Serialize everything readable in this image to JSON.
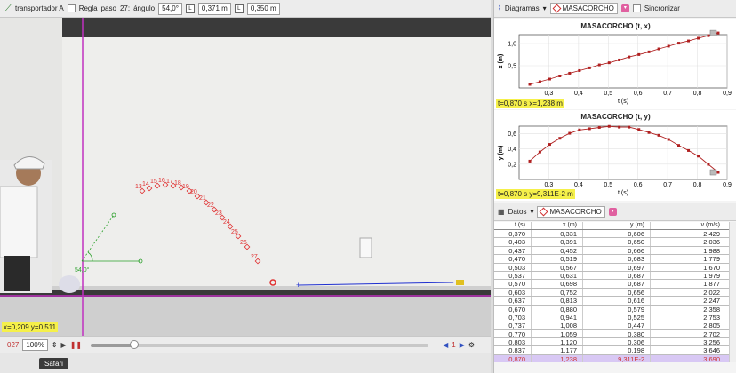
{
  "toolbar": {
    "track_name": "transportador A",
    "ruler_label": "Regla",
    "step_label": "paso",
    "step_value": "27:",
    "angle_label": "ángulo",
    "angle_value": "54,0°",
    "L1_label": "L",
    "L1_value": "0,371 m",
    "L2_label": "L",
    "L2_value": "0,350 m"
  },
  "video": {
    "readout": "x=0,209  y=0,511",
    "angle_marker": "54,0°",
    "point_labels": [
      "13",
      "14",
      "15",
      "16",
      "17",
      "18",
      "19",
      "20",
      "21",
      "22",
      "23",
      "24",
      "25",
      "26",
      "27"
    ]
  },
  "player": {
    "frame": "027",
    "zoom": "100%",
    "step_count": "1",
    "progress": 0.13
  },
  "tooltip": "Safari",
  "right": {
    "diagrams_label": "Diagramas",
    "object_name": "MASACORCHO",
    "sync_label": "Sincronizar",
    "data_label": "Datos",
    "plot1": {
      "title": "MASACORCHO (t, x)",
      "ylabel": "x (m)",
      "xlabel": "t (s)",
      "readout": "t=0,870 s  x=1,238 m"
    },
    "plot2": {
      "title": "MASACORCHO (t, y)",
      "ylabel": "y (m)",
      "xlabel": "t (s)",
      "readout": "t=0,870 s  y=9,311E-2 m"
    }
  },
  "table": {
    "headers": [
      "t (s)",
      "x (m)",
      "y (m)",
      "v (m/s)"
    ],
    "rows": [
      [
        "0,370",
        "0,331",
        "0,606",
        "2,429"
      ],
      [
        "0,403",
        "0,391",
        "0,650",
        "2,036"
      ],
      [
        "0,437",
        "0,452",
        "0,666",
        "1,988"
      ],
      [
        "0,470",
        "0,519",
        "0,683",
        "1,779"
      ],
      [
        "0,503",
        "0,567",
        "0,697",
        "1,670"
      ],
      [
        "0,537",
        "0,631",
        "0,687",
        "1,979"
      ],
      [
        "0,570",
        "0,698",
        "0,687",
        "1,877"
      ],
      [
        "0,603",
        "0,752",
        "0,656",
        "2,022"
      ],
      [
        "0,637",
        "0,813",
        "0,616",
        "2,247"
      ],
      [
        "0,670",
        "0,880",
        "0,579",
        "2,358"
      ],
      [
        "0,703",
        "0,941",
        "0,525",
        "2,753"
      ],
      [
        "0,737",
        "1,008",
        "0,447",
        "2,805"
      ],
      [
        "0,770",
        "1,059",
        "0,380",
        "2,702"
      ],
      [
        "0,803",
        "1,120",
        "0,306",
        "3,256"
      ],
      [
        "0,837",
        "1,177",
        "0,198",
        "3,646"
      ],
      [
        "0,870",
        "1,238",
        "9,311E-2",
        "3,690"
      ]
    ],
    "selected_index": 15
  },
  "chart_data": [
    {
      "type": "scatter",
      "title": "MASACORCHO (t, x)",
      "xlabel": "t (s)",
      "ylabel": "x (m)",
      "xlim": [
        0.2,
        0.9
      ],
      "ylim": [
        0,
        1.2
      ],
      "xticks": [
        "0,3",
        "0,4",
        "0,5",
        "0,6",
        "0,7",
        "0,8",
        "0,9"
      ],
      "yticks": [
        "0,5",
        "1,0"
      ],
      "x": [
        0.236,
        0.27,
        0.303,
        0.337,
        0.37,
        0.403,
        0.437,
        0.47,
        0.503,
        0.537,
        0.57,
        0.603,
        0.637,
        0.67,
        0.703,
        0.737,
        0.77,
        0.803,
        0.837,
        0.87
      ],
      "y": [
        0.08,
        0.14,
        0.2,
        0.27,
        0.331,
        0.391,
        0.452,
        0.519,
        0.567,
        0.631,
        0.698,
        0.752,
        0.813,
        0.88,
        0.941,
        1.008,
        1.059,
        1.12,
        1.177,
        1.238
      ]
    },
    {
      "type": "scatter",
      "title": "MASACORCHO (t, y)",
      "xlabel": "t (s)",
      "ylabel": "y (m)",
      "xlim": [
        0.2,
        0.9
      ],
      "ylim": [
        0,
        0.7
      ],
      "xticks": [
        "0,3",
        "0,4",
        "0,5",
        "0,6",
        "0,7",
        "0,8",
        "0,9"
      ],
      "yticks": [
        "0,2",
        "0,4",
        "0,6"
      ],
      "x": [
        0.236,
        0.27,
        0.303,
        0.337,
        0.37,
        0.403,
        0.437,
        0.47,
        0.503,
        0.537,
        0.57,
        0.603,
        0.637,
        0.67,
        0.703,
        0.737,
        0.77,
        0.803,
        0.837,
        0.87
      ],
      "y": [
        0.24,
        0.36,
        0.46,
        0.54,
        0.606,
        0.65,
        0.666,
        0.683,
        0.697,
        0.687,
        0.687,
        0.656,
        0.616,
        0.579,
        0.525,
        0.447,
        0.38,
        0.306,
        0.198,
        0.0931
      ]
    }
  ]
}
